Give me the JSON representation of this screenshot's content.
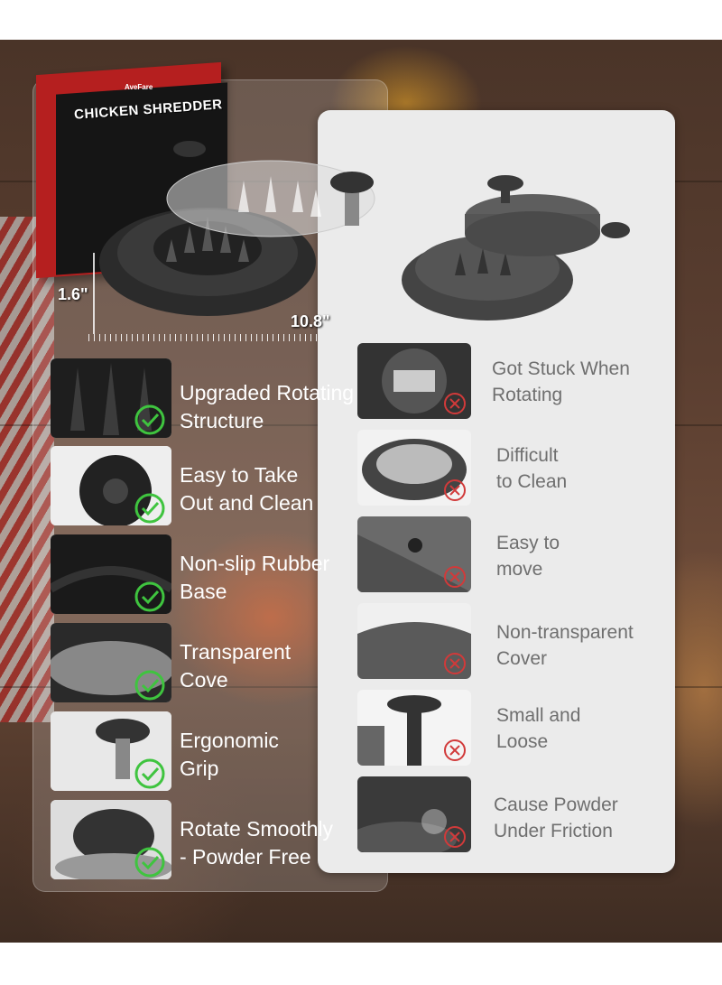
{
  "box": {
    "brand": "AveFare",
    "title": "CHICKEN SHREDDER"
  },
  "dimensions": {
    "height": "1.6\"",
    "width": "10.8\""
  },
  "features": [
    {
      "line1": "Upgraded Rotating",
      "line2": "Structure"
    },
    {
      "line1": "Easy to Take",
      "line2": "Out and Clean"
    },
    {
      "line1": "Non-slip Rubber",
      "line2": "Base"
    },
    {
      "line1": "Transparent",
      "line2": "Cove"
    },
    {
      "line1": "Ergonomic",
      "line2": "Grip"
    },
    {
      "line1": "Rotate Smoothly",
      "line2": "- Powder Free"
    }
  ],
  "drawbacks": [
    {
      "line1": "Got Stuck When",
      "line2": "Rotating"
    },
    {
      "line1": "Difficult",
      "line2": "to Clean"
    },
    {
      "line1": "Easy to",
      "line2": "move"
    },
    {
      "line1": "Non-transparent",
      "line2": "Cover"
    },
    {
      "line1": "Small and",
      "line2": "Loose"
    },
    {
      "line1": "Cause Powder",
      "line2": "Under Friction"
    }
  ],
  "colors": {
    "check": "#3fc43f",
    "cross": "#d13a3a",
    "box_red": "#b51f1f"
  },
  "icons": {
    "good": "check-circle-icon",
    "bad": "cross-circle-icon"
  }
}
